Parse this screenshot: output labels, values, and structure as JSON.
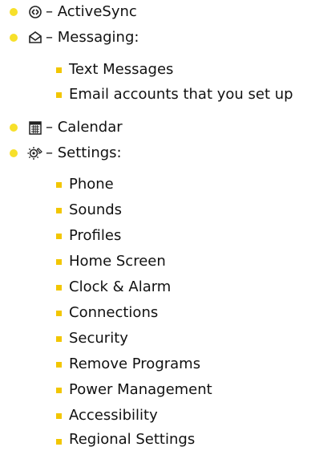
{
  "colors": {
    "bullet_level1": "#f7e02a",
    "bullet_level2": "#f2c600"
  },
  "items": [
    {
      "icon": "activesync-icon",
      "label": "– ActiveSync"
    },
    {
      "icon": "messaging-icon",
      "label": "– Messaging:",
      "children": [
        "Text Messages",
        "Email accounts that you set up"
      ]
    },
    {
      "icon": "calendar-icon",
      "label": "– Calendar"
    },
    {
      "icon": "settings-icon",
      "label": "– Settings:",
      "children": [
        "Phone",
        "Sounds",
        "Profiles",
        "Home Screen",
        "Clock & Alarm",
        "Connections",
        "Security",
        "Remove Programs",
        "Power Management",
        "Accessibility",
        "Regional Settings"
      ]
    }
  ]
}
